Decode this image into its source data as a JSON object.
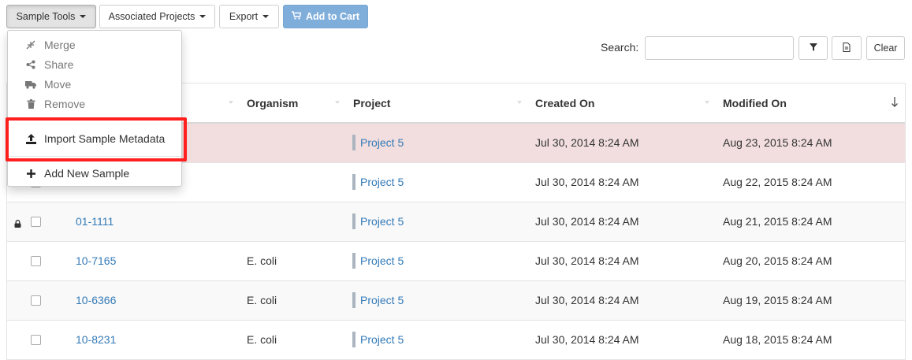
{
  "toolbar": {
    "sample_tools": "Sample Tools",
    "associated_projects": "Associated Projects",
    "export": "Export",
    "add_to_cart": "Add to Cart"
  },
  "search": {
    "label": "Search:",
    "value": "",
    "placeholder": "",
    "clear_label": "Clear"
  },
  "table": {
    "columns": [
      "Organism",
      "Project",
      "Created On",
      "Modified On"
    ],
    "rows": [
      {
        "name": "",
        "organism": "",
        "project": "Project 5",
        "created": "Jul 30, 2014 8:24 AM",
        "modified": "Aug 23, 2015 8:24 AM",
        "locked": false
      },
      {
        "name": "",
        "organism": "",
        "project": "Project 5",
        "created": "Jul 30, 2014 8:24 AM",
        "modified": "Aug 22, 2015 8:24 AM",
        "locked": false
      },
      {
        "name": "01-1111",
        "organism": "",
        "project": "Project 5",
        "created": "Jul 30, 2014 8:24 AM",
        "modified": "Aug 21, 2015 8:24 AM",
        "locked": true
      },
      {
        "name": "10-7165",
        "organism": "E. coli",
        "project": "Project 5",
        "created": "Jul 30, 2014 8:24 AM",
        "modified": "Aug 20, 2015 8:24 AM",
        "locked": false
      },
      {
        "name": "10-6366",
        "organism": "E. coli",
        "project": "Project 5",
        "created": "Jul 30, 2014 8:24 AM",
        "modified": "Aug 19, 2015 8:24 AM",
        "locked": false
      },
      {
        "name": "10-8231",
        "organism": "E. coli",
        "project": "Project 5",
        "created": "Jul 30, 2014 8:24 AM",
        "modified": "Aug 18, 2015 8:24 AM",
        "locked": false
      }
    ]
  },
  "dropdown": {
    "items": [
      {
        "label": "Merge",
        "icon": "compress-icon",
        "disabled": true
      },
      {
        "label": "Share",
        "icon": "share-icon",
        "disabled": true
      },
      {
        "label": "Move",
        "icon": "truck-icon",
        "disabled": true
      },
      {
        "label": "Remove",
        "icon": "trash-icon",
        "disabled": true
      },
      {
        "label": "Import Sample Metadata",
        "icon": "upload-icon",
        "disabled": false
      },
      {
        "label": "Add New Sample",
        "icon": "plus-icon",
        "disabled": false
      }
    ]
  },
  "colors": {
    "highlight_row": "#f2dede",
    "link": "#337ab7",
    "primary_button": "#80aedb",
    "annotation_box": "#ff1f1f"
  }
}
